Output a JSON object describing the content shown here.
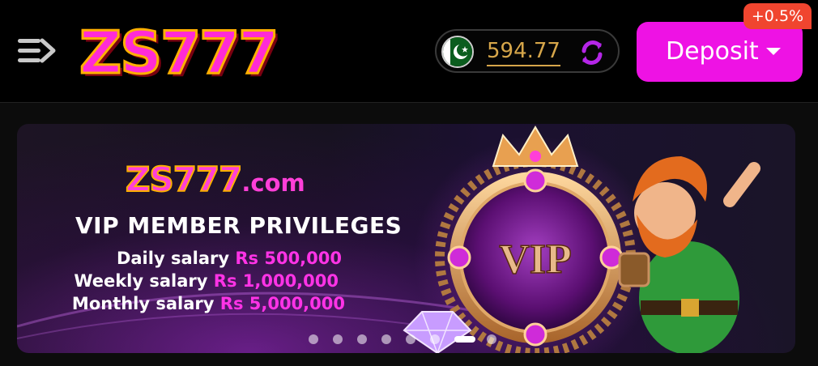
{
  "header": {
    "logo_text": "ZS777",
    "balance": {
      "currency_icon": "pakistan-flag",
      "value": "594.77",
      "refresh_icon": "refresh-icon"
    },
    "deposit": {
      "label": "Deposit",
      "bonus_badge": "+0.5%"
    }
  },
  "banner": {
    "logo_main": "ZS777",
    "logo_domain": ".com",
    "title": "VIP MEMBER PRIVILEGES",
    "salaries": [
      {
        "label": "Daily salary",
        "amount": "Rs 500,000"
      },
      {
        "label": "Weekly salary",
        "amount": "Rs 1,000,000"
      },
      {
        "label": "Monthly salary",
        "amount": "Rs  5,000,000"
      }
    ],
    "badge_text": "VIP",
    "slides": {
      "total": 8,
      "active_index": 6
    }
  },
  "colors": {
    "accent": "#ee12e4",
    "balance": "#d6a64a",
    "badge": "#f0452f",
    "salary_amount": "#ff33e6"
  }
}
